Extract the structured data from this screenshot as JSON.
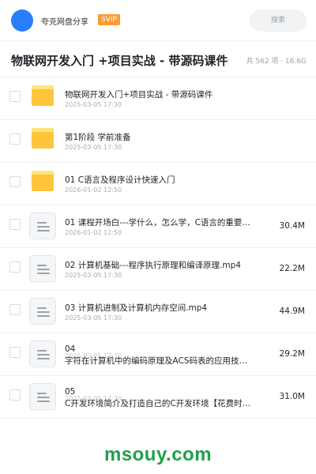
{
  "topbar": {
    "app_name": "夸克网盘分享",
    "badge": "SVIP",
    "search_label": "搜索",
    "avatar_icon": "user-avatar-icon",
    "accent_color": "#2a7dfc"
  },
  "header": {
    "title": "物联网开发入门 +项目实战 - 带源码课件",
    "meta": "共 562 项 · 16.6G"
  },
  "files": [
    {
      "type": "folder",
      "name": "物联网开发入门+项目实战 - 带源码课件",
      "date": "2025-03-05 17:30",
      "size": ""
    },
    {
      "type": "folder",
      "name": "第1阶段 学前准备",
      "date": "2025-03-05 17:30",
      "size": ""
    },
    {
      "type": "folder",
      "name": "01 C语言及程序设计快速入门",
      "date": "2026-01-02 12:50",
      "size": ""
    },
    {
      "type": "file",
      "name": "01 课程开场白---学什么，怎么学，C语言的重要…",
      "date": "2026-01-02 12:50",
      "size": "30.4M"
    },
    {
      "type": "file",
      "name": "02 计算机基础---程序执行原理和编译原理.mp4",
      "date": "2025-03-05 17:30",
      "size": "22.2M"
    },
    {
      "type": "file",
      "name": "03 计算机进制及计算机内存空间.mp4",
      "date": "2025-03-05 17:30",
      "size": "44.9M"
    },
    {
      "type": "file2",
      "name": "04",
      "name2": "字符在计算机中的编码原理及ACS码表的应用技…",
      "date": "2025-03-05 17:30",
      "size": "29.2M"
    },
    {
      "type": "file2",
      "name": "05",
      "name2": "C开发环境简介及打造自己的C开发环境【花费时…",
      "date": "2025-03-05 17:30",
      "size": "31.0M"
    }
  ],
  "icons": {
    "folder": "folder-icon",
    "file": "video-file-icon",
    "checkbox": "checkbox-icon"
  },
  "footer": {
    "brand": "msouy.com",
    "brand_color": "#1fa04a"
  }
}
